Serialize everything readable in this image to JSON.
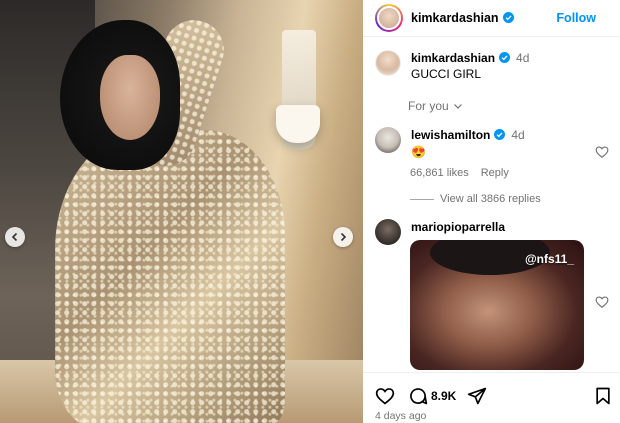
{
  "post": {
    "username": "kimkardashian",
    "follow_label": "Follow",
    "caption_text": "GUCCI GIRL",
    "caption_time": "4d",
    "for_you_label": "For you",
    "time_ago": "4 days ago"
  },
  "comments": [
    {
      "username": "lewishamilton",
      "time": "4d",
      "text": "😍",
      "likes": "66,861 likes",
      "reply_label": "Reply",
      "view_replies": "View all 3866 replies"
    },
    {
      "username": "mariopioparrella",
      "gif_tag": "@nfs11_"
    }
  ],
  "actions": {
    "comment_count": "8.9K"
  },
  "colors": {
    "accent": "#0095f6",
    "muted": "#737373"
  },
  "icons": [
    "chevron-left-icon",
    "chevron-right-icon",
    "verified-icon",
    "chevron-down-icon",
    "heart-icon",
    "comment-icon",
    "share-icon",
    "bookmark-icon"
  ]
}
